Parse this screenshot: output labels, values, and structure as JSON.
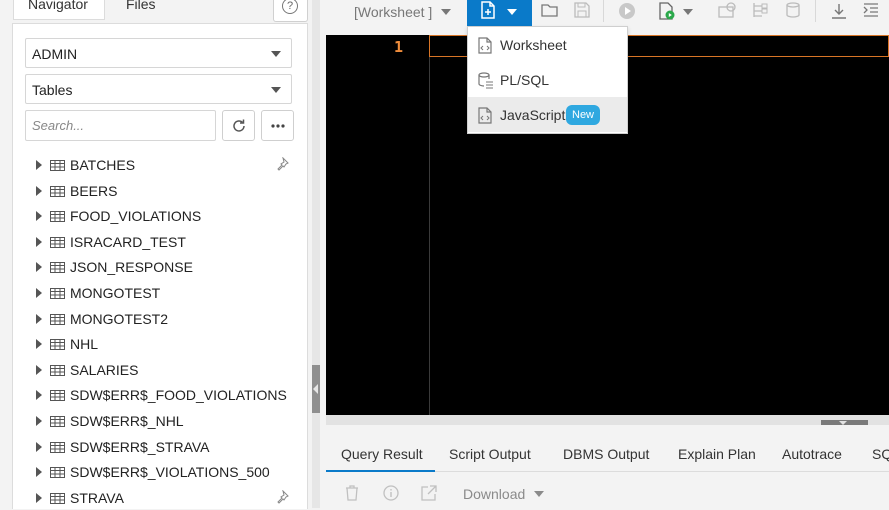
{
  "navigator": {
    "tabs": [
      {
        "label": "Navigator"
      },
      {
        "label": "Files"
      }
    ],
    "help_icon": "question-circle-icon",
    "schema_select": "ADMIN",
    "object_type_select": "Tables",
    "search": {
      "placeholder": "Search...",
      "value": ""
    },
    "tables": [
      {
        "name": "BATCHES",
        "pinned": true
      },
      {
        "name": "BEERS"
      },
      {
        "name": "FOOD_VIOLATIONS"
      },
      {
        "name": "ISRACARD_TEST"
      },
      {
        "name": "JSON_RESPONSE"
      },
      {
        "name": "MONGOTEST"
      },
      {
        "name": "MONGOTEST2"
      },
      {
        "name": "NHL"
      },
      {
        "name": "SALARIES"
      },
      {
        "name": "SDW$ERR$_FOOD_VIOLATIONS"
      },
      {
        "name": "SDW$ERR$_NHL"
      },
      {
        "name": "SDW$ERR$_STRAVA"
      },
      {
        "name": "SDW$ERR$_VIOLATIONS_500"
      },
      {
        "name": "STRAVA",
        "pinned": true
      }
    ]
  },
  "toolbar": {
    "worksheet_select": "[Worksheet ]",
    "accent_color": "#0a7ac9"
  },
  "new_menu": {
    "items": [
      {
        "label": "Worksheet",
        "icon": "sql-file-icon"
      },
      {
        "label": "PL/SQL",
        "icon": "plsql-icon"
      },
      {
        "label": "JavaScript",
        "icon": "js-file-icon",
        "badge": "New"
      }
    ]
  },
  "editor": {
    "line_number": "1",
    "background": "#000000",
    "line_number_color": "#f08d3c"
  },
  "results": {
    "tabs": [
      {
        "label": "Query Result"
      },
      {
        "label": "Script Output"
      },
      {
        "label": "DBMS Output"
      },
      {
        "label": "Explain Plan"
      },
      {
        "label": "Autotrace"
      },
      {
        "label": "SQ"
      }
    ],
    "download_label": "Download"
  }
}
